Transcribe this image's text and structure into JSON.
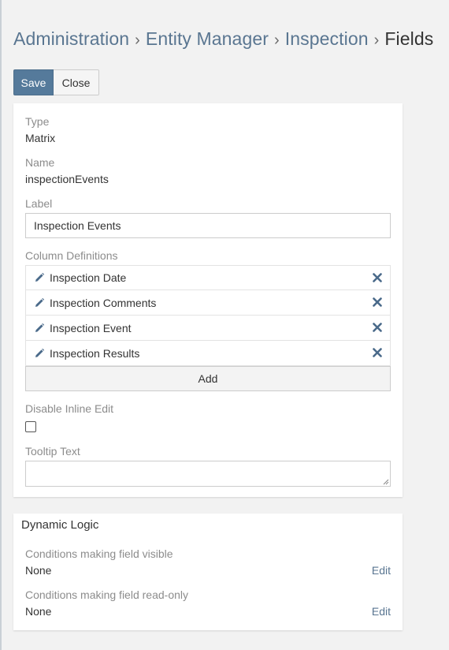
{
  "breadcrumb": {
    "items": [
      "Administration",
      "Entity Manager",
      "Inspection"
    ],
    "current": "Fields",
    "separator": "›"
  },
  "toolbar": {
    "save_label": "Save",
    "close_label": "Close"
  },
  "field": {
    "type_label": "Type",
    "type_value": "Matrix",
    "name_label": "Name",
    "name_value": "inspectionEvents",
    "label_label": "Label",
    "label_value": "Inspection Events",
    "columns_label": "Column Definitions",
    "columns": [
      {
        "label": "Inspection Date"
      },
      {
        "label": "Inspection Comments"
      },
      {
        "label": "Inspection Event"
      },
      {
        "label": "Inspection Results"
      }
    ],
    "add_label": "Add",
    "disable_inline_edit_label": "Disable Inline Edit",
    "disable_inline_edit_checked": false,
    "tooltip_label": "Tooltip Text",
    "tooltip_value": ""
  },
  "dynamic_logic": {
    "title": "Dynamic Logic",
    "visible_label": "Conditions making field visible",
    "visible_value": "None",
    "readonly_label": "Conditions making field read-only",
    "readonly_value": "None",
    "edit_label": "Edit"
  },
  "icons": {
    "edit": "pencil-icon",
    "remove": "remove-icon"
  },
  "colors": {
    "primary": "#557a9b",
    "link": "#5a7691",
    "remove": "#4a6a8a"
  }
}
